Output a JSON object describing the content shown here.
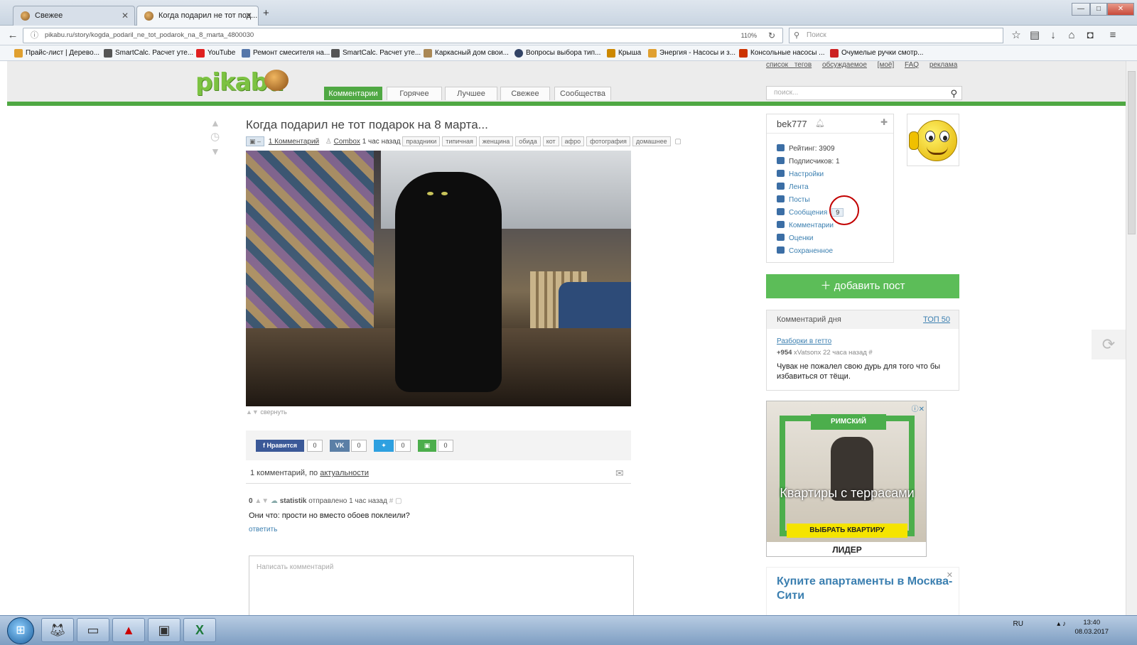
{
  "browser": {
    "tabs": [
      {
        "label": "Свежее",
        "active": false
      },
      {
        "label": "Когда подарил не тот под...",
        "active": true
      }
    ],
    "new_tab": "+",
    "url": "pikabu.ru/story/kogda_podaril_ne_tot_podarok_na_8_marta_4800030",
    "zoom": "110%",
    "search_placeholder": "Поиск",
    "window_controls": {
      "minimize": "—",
      "maximize": "□",
      "close": "✕"
    },
    "bookmarks": [
      {
        "label": "Прайс-лист | Деревo...",
        "color": "#e0a030"
      },
      {
        "label": "SmartCalc. Расчет уте...",
        "color": "#555555"
      },
      {
        "label": "YouTube",
        "color": "#e02020"
      },
      {
        "label": "Ремонт смесителя на...",
        "color": "#5577aa"
      },
      {
        "label": "SmartCalc. Расчет уте...",
        "color": "#555555"
      },
      {
        "label": "Каркасный дом свои...",
        "color": "#aa8855"
      },
      {
        "label": "Вопросы выбора тип...",
        "color": "#334466"
      },
      {
        "label": "Крыша",
        "color": "#cc8800"
      },
      {
        "label": "Энергия - Насосы и з...",
        "color": "#e0a030"
      },
      {
        "label": "Консольные насосы ...",
        "color": "#cc3300"
      },
      {
        "label": "Очумелые ручки смотр...",
        "color": "#cc2222"
      }
    ]
  },
  "header": {
    "logo": "pikabu",
    "top_links": [
      "список тегов",
      "обсуждаемое",
      "[моё]",
      "FAQ",
      "реклама"
    ],
    "nav_tabs": [
      {
        "label": "Комментарии",
        "active": true
      },
      {
        "label": "Горячее",
        "active": false
      },
      {
        "label": "Лучшее",
        "active": false
      },
      {
        "label": "Свежее",
        "active": false
      },
      {
        "label": "Сообщества",
        "active": false
      }
    ],
    "search_placeholder": "поиск..."
  },
  "post": {
    "title": "Когда подарил не тот подарок на 8 марта...",
    "comments_link": "1 Комментарий",
    "author": "Combox",
    "time": "1 час назад",
    "tags": [
      "праздники",
      "типичная",
      "женщина",
      "обида",
      "кот",
      "афро",
      "фотография",
      "домашнее"
    ],
    "collapse_label": "свернуть"
  },
  "share": {
    "fb_label": "Нравится",
    "fb_count": "0",
    "vk_count": "0",
    "tw_count": "0",
    "other_count": "0"
  },
  "comments": {
    "summary_prefix": "1 комментарий, по",
    "summary_sort": "актуальности",
    "items": [
      {
        "rating": "0",
        "author": "statistik",
        "action": "отправлено",
        "time": "1 час назад",
        "text": "Они что: прости но вместо обоев поклеили?",
        "reply": "ответить"
      }
    ],
    "input_placeholder": "Написать комментарий"
  },
  "sidebar": {
    "username": "bek777",
    "profile_items": [
      {
        "label": "Рейтинг: 3909",
        "style": "gray"
      },
      {
        "label": "Подписчиков: 1",
        "style": "gray"
      },
      {
        "label": "Настройки",
        "style": "blue"
      },
      {
        "label": "Лента",
        "style": "blue"
      },
      {
        "label": "Посты",
        "style": "blue"
      },
      {
        "label": "Сообщения",
        "style": "blue",
        "badge": "9"
      },
      {
        "label": "Комментарии",
        "style": "blue"
      },
      {
        "label": "Оценки",
        "style": "blue"
      },
      {
        "label": "Сохраненное",
        "style": "blue"
      }
    ],
    "add_post_label": "добавить пост",
    "comment_of_day": {
      "title": "Комментарий дня",
      "top_link": "ТОП 50",
      "post_link": "Разборки в гетто",
      "rating": "+954",
      "author": "xVatsonx",
      "time": "22 часа назад",
      "text": "Чувак не пожалел свою дурь для того что бы избавиться от тёщи."
    },
    "ad": {
      "brand_top": "РИМСКИЙ",
      "headline": "Квартиры с террасами",
      "cta": "ВЫБРАТЬ КВАРТИРУ",
      "brand_bottom": "ЛИДЕР"
    },
    "ad2": {
      "title": "Купите апартаменты в Москва-Сити"
    }
  },
  "taskbar": {
    "lang": "RU",
    "time": "13:40",
    "date": "08.03.2017"
  }
}
